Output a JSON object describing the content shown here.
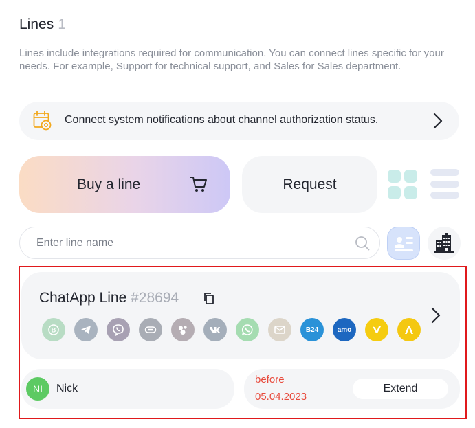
{
  "header": {
    "title": "Lines",
    "count": "1"
  },
  "description": "Lines include integrations required for communication. You can connect lines specific for your needs. For example, Support for technical support, and Sales for Sales department.",
  "notice": {
    "text": "Connect system notifications about channel authorization status."
  },
  "actions": {
    "buy_label": "Buy a line",
    "request_label": "Request"
  },
  "search": {
    "placeholder": "Enter line name",
    "value": ""
  },
  "line": {
    "name": "ChatApp Line",
    "number": "#28694",
    "channels": [
      {
        "icon": "whatsapp-business-icon",
        "color": "#b8dcc4"
      },
      {
        "icon": "telegram-icon",
        "color": "#a9b3bf"
      },
      {
        "icon": "viber-icon",
        "color": "#a8a1b3"
      },
      {
        "icon": "avito-icon",
        "color": "#a9adb5"
      },
      {
        "icon": "dots-messenger-icon",
        "color": "#b5adb3"
      },
      {
        "icon": "vk-icon",
        "color": "#a4aeba"
      },
      {
        "icon": "whatsapp-icon",
        "color": "#a5dcb1"
      },
      {
        "icon": "email-icon",
        "color": "#dcd5c9"
      },
      {
        "icon": "bitrix24-icon",
        "label": "B24",
        "color": "#2a92d8"
      },
      {
        "icon": "amocrm-icon",
        "label": "amo",
        "color": "#1d67c0"
      },
      {
        "icon": "yandex-icon",
        "color": "#f5cc10"
      },
      {
        "icon": "alfa-icon",
        "color": "#f4c812"
      }
    ],
    "user": {
      "initials": "NI",
      "name": "Nick"
    },
    "expiry": {
      "prefix": "before",
      "date": "05.04.2023"
    },
    "extend_label": "Extend"
  },
  "colors": {
    "accent_red": "#e84a3c",
    "highlight_frame": "#e0191c",
    "avatar_green": "#5dca63",
    "notice_icon": "#f2a81d"
  }
}
